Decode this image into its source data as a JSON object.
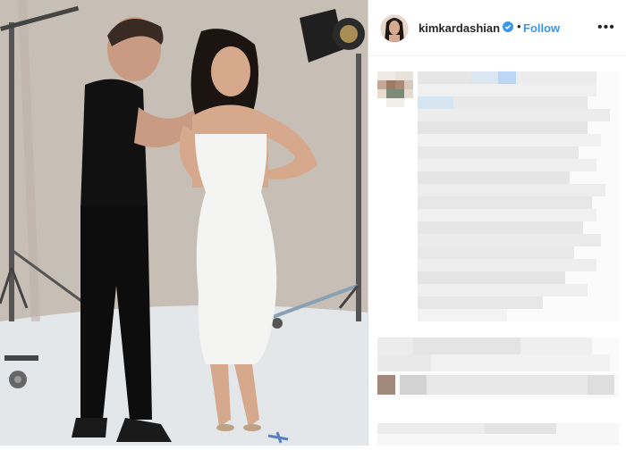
{
  "post": {
    "author": {
      "username": "kimkardashian",
      "follow_label": "Follow",
      "verified": true
    },
    "icons": {
      "verified": "verified-badge-icon",
      "more": "more-options-icon"
    },
    "colors": {
      "link": "#3897f0",
      "text": "#262626",
      "divider": "#dbdbdb"
    }
  }
}
